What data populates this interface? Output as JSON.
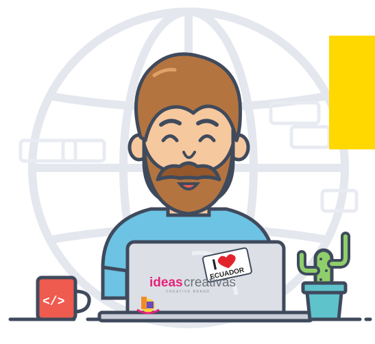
{
  "illustration": {
    "sticker": {
      "line1": "I",
      "line2": "ECUADOR"
    },
    "laptop_brand": {
      "part1": "ideas",
      "part2": "creativas",
      "tagline": "CREATIVE BRAND"
    },
    "mug_symbol": "</>"
  },
  "colors": {
    "yellow": "#ffd800",
    "outline": "#3f4a5c",
    "hair": "#b4743f",
    "hair_dark": "#94582c",
    "skin": "#f6c89e",
    "shirt": "#6cc3e3",
    "laptop": "#dcdfe6",
    "mug": "#ef5b4f",
    "cactus": "#8fcf6b",
    "pot": "#5fc3cc",
    "globe": "#e6e9ef"
  },
  "icons": [
    "globe-icon",
    "heart-icon",
    "code-icon"
  ]
}
